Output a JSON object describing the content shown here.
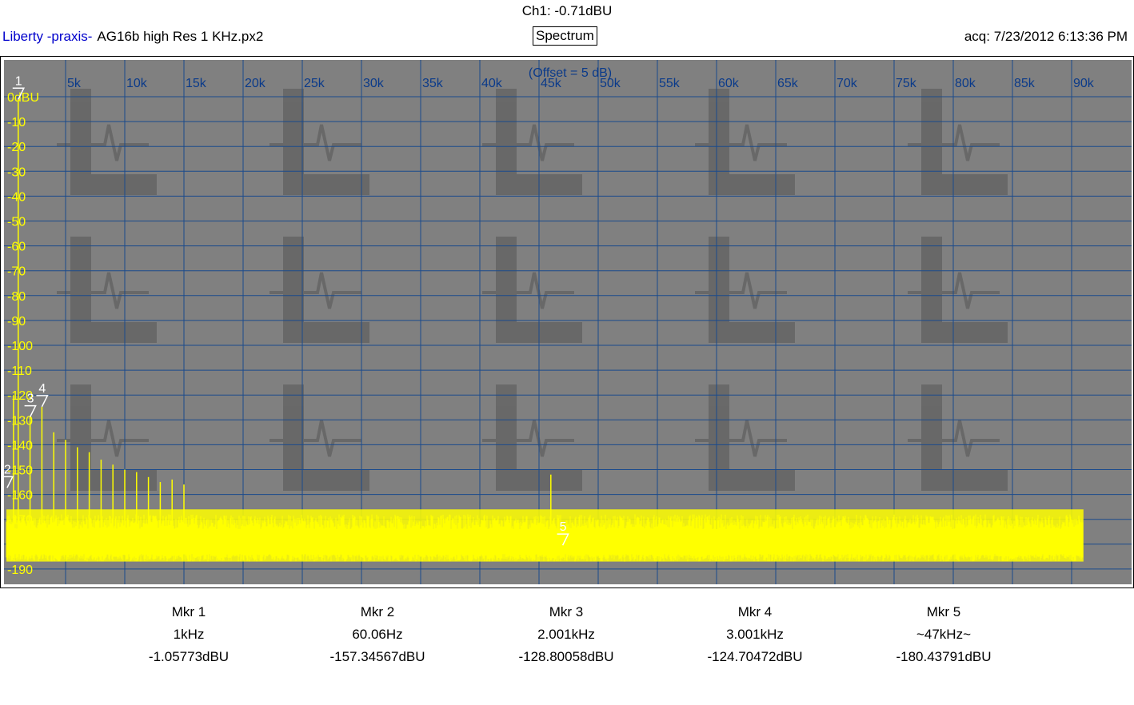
{
  "header": {
    "channel_readout": "Ch1: -0.71dBU",
    "app_name": "Liberty -praxis-",
    "file_name": "AG16b high Res 1 KHz.px2",
    "view_mode": "Spectrum",
    "acq_time": "acq: 7/23/2012 6:13:36 PM"
  },
  "plot": {
    "offset_label": "(Offset = 5 dB)",
    "colors": {
      "background": "#808080",
      "grid": "#1a4a8c",
      "trace": "#ffff00",
      "x_labels": "#0a3a8a",
      "y_labels": "#ffff00",
      "markers": "#ffffff"
    }
  },
  "chart_data": {
    "type": "line",
    "title": "",
    "xlabel": "",
    "ylabel": "",
    "x_unit": "Hz",
    "y_unit": "dBU",
    "xlim": [
      0,
      92500
    ],
    "ylim": [
      -195,
      5
    ],
    "x_ticks": [
      5000,
      10000,
      15000,
      20000,
      25000,
      30000,
      35000,
      40000,
      45000,
      50000,
      55000,
      60000,
      65000,
      70000,
      75000,
      80000,
      85000,
      90000
    ],
    "x_tick_labels": [
      "5k",
      "10k",
      "15k",
      "20k",
      "25k",
      "30k",
      "35k",
      "40k",
      "45k",
      "50k",
      "55k",
      "60k",
      "65k",
      "70k",
      "75k",
      "80k",
      "85k",
      "90k"
    ],
    "y_ticks": [
      0,
      -10,
      -20,
      -30,
      -40,
      -50,
      -60,
      -70,
      -80,
      -90,
      -100,
      -110,
      -120,
      -130,
      -140,
      -150,
      -160,
      -170,
      -180,
      -190
    ],
    "y_tick_labels": [
      "0dBU",
      "-10",
      "-20",
      "-30",
      "-40",
      "-50",
      "-60",
      "-70",
      "-80",
      "-90",
      "-100",
      "-110",
      "-120",
      "-130",
      "-140",
      "-150",
      "-160",
      "-170",
      "-180",
      "-190"
    ],
    "grid": true,
    "series": [
      {
        "noise_floor_dBU": -175,
        "noise_floor_top_dBU": -168,
        "noise_floor_bottom_dBU": -187,
        "x_end_Hz": 91000
      }
    ],
    "harmonics": [
      {
        "x": 1000,
        "y": -1.06
      },
      {
        "x": 2000,
        "y": -128.8
      },
      {
        "x": 3000,
        "y": -124.7
      },
      {
        "x": 4000,
        "y": -135
      },
      {
        "x": 5000,
        "y": -138
      },
      {
        "x": 6000,
        "y": -141
      },
      {
        "x": 7000,
        "y": -143
      },
      {
        "x": 8000,
        "y": -146
      },
      {
        "x": 9000,
        "y": -148
      },
      {
        "x": 10000,
        "y": -150
      },
      {
        "x": 11000,
        "y": -151
      },
      {
        "x": 12000,
        "y": -153
      },
      {
        "x": 13000,
        "y": -155
      },
      {
        "x": 14000,
        "y": -154
      },
      {
        "x": 15000,
        "y": -156
      },
      {
        "x": 46000,
        "y": -152
      }
    ],
    "markers": [
      {
        "label": "1",
        "x": 1000,
        "y": -1.05773
      },
      {
        "label": "2",
        "x": 60.06,
        "y": -157.34567
      },
      {
        "label": "3",
        "x": 2001,
        "y": -128.80058
      },
      {
        "label": "4",
        "x": 3001,
        "y": -124.70472
      },
      {
        "label": "5",
        "x": 47000,
        "y": -180.43791
      }
    ]
  },
  "markers_table": [
    {
      "name": "Mkr 1",
      "freq": "1kHz",
      "level": "-1.05773dBU"
    },
    {
      "name": "Mkr 2",
      "freq": "60.06Hz",
      "level": "-157.34567dBU"
    },
    {
      "name": "Mkr 3",
      "freq": "2.001kHz",
      "level": "-128.80058dBU"
    },
    {
      "name": "Mkr 4",
      "freq": "3.001kHz",
      "level": "-124.70472dBU"
    },
    {
      "name": "Mkr 5",
      "freq": "~47kHz~",
      "level": "-180.43791dBU"
    }
  ]
}
